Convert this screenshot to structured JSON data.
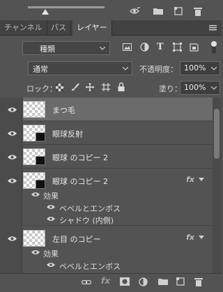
{
  "tabs": [
    {
      "label": "チャンネル",
      "active": false
    },
    {
      "label": "パス",
      "active": false
    },
    {
      "label": "レイヤー",
      "active": true
    }
  ],
  "filter": {
    "kind_label": "種類"
  },
  "blend": {
    "mode": "通常",
    "opacity_label": "不透明度：",
    "opacity_value": "100%"
  },
  "lock": {
    "label": "ロック：",
    "fill_label": "塗り：",
    "fill_value": "100%"
  },
  "layers": [
    {
      "name": "まつ毛",
      "selected": true
    },
    {
      "name": "眼球反射",
      "selected": false
    },
    {
      "name": "眼球 のコピー 2",
      "selected": false
    },
    {
      "name": "眼球 のコピー 2",
      "selected": false,
      "fx": "fx"
    },
    {
      "name": "左目 のコピー",
      "selected": false,
      "fx": "fx"
    }
  ],
  "effects": {
    "group_label": "効果",
    "bevel": "ベベルとエンボス",
    "inner_shadow": "シャドウ (内側)"
  },
  "colors": {
    "panel": "#535353",
    "selected_row": "#6b6b6b",
    "tabbar": "#424242"
  }
}
